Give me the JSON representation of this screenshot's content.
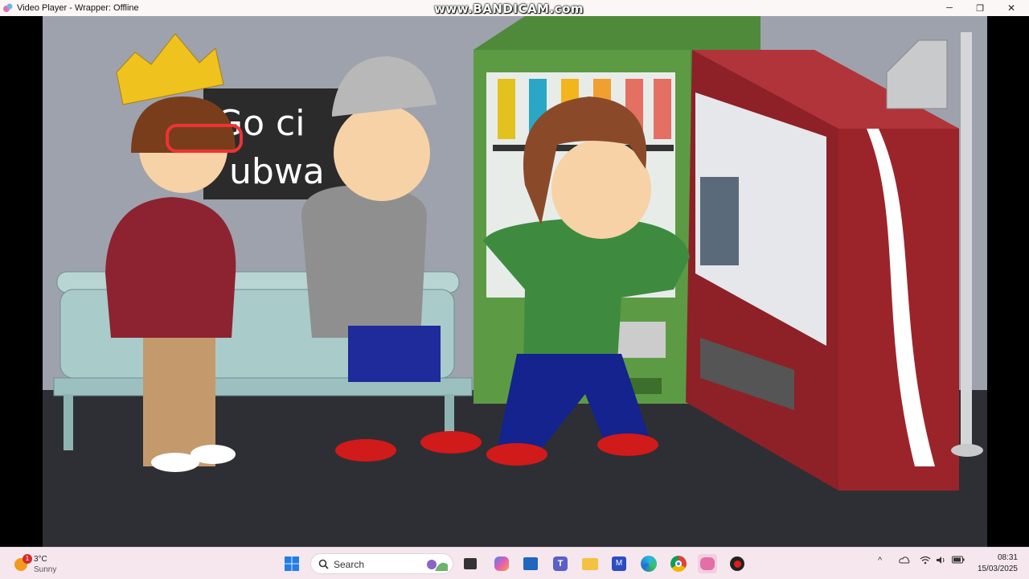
{
  "window": {
    "title": "Video Player - Wrapper: Offline",
    "watermark": "www.BANDICAM.com",
    "controls": {
      "minimize": "─",
      "maximize": "❐",
      "close": "✕"
    }
  },
  "scene": {
    "sign_line1": "Go ci",
    "sign_line2": "ubwa"
  },
  "taskbar": {
    "weather": {
      "temp": "3°C",
      "condition": "Sunny",
      "badge": "1"
    },
    "search_label": "Search",
    "apps": [
      "start-icon",
      "search-icon",
      "widget-icon",
      "file-manager-icon",
      "copilot-icon",
      "store-icon",
      "teams-icon",
      "folder-icon",
      "editor-icon",
      "edge-icon",
      "chrome-icon",
      "wrapper-icon",
      "record-icon"
    ],
    "tray": {
      "chevron": "^",
      "clock_time": "08:31",
      "clock_date": "15/03/2025"
    }
  },
  "colors": {
    "taskbar_bg": "#f6e7ee",
    "titlebar_bg": "#fbf7f7"
  }
}
